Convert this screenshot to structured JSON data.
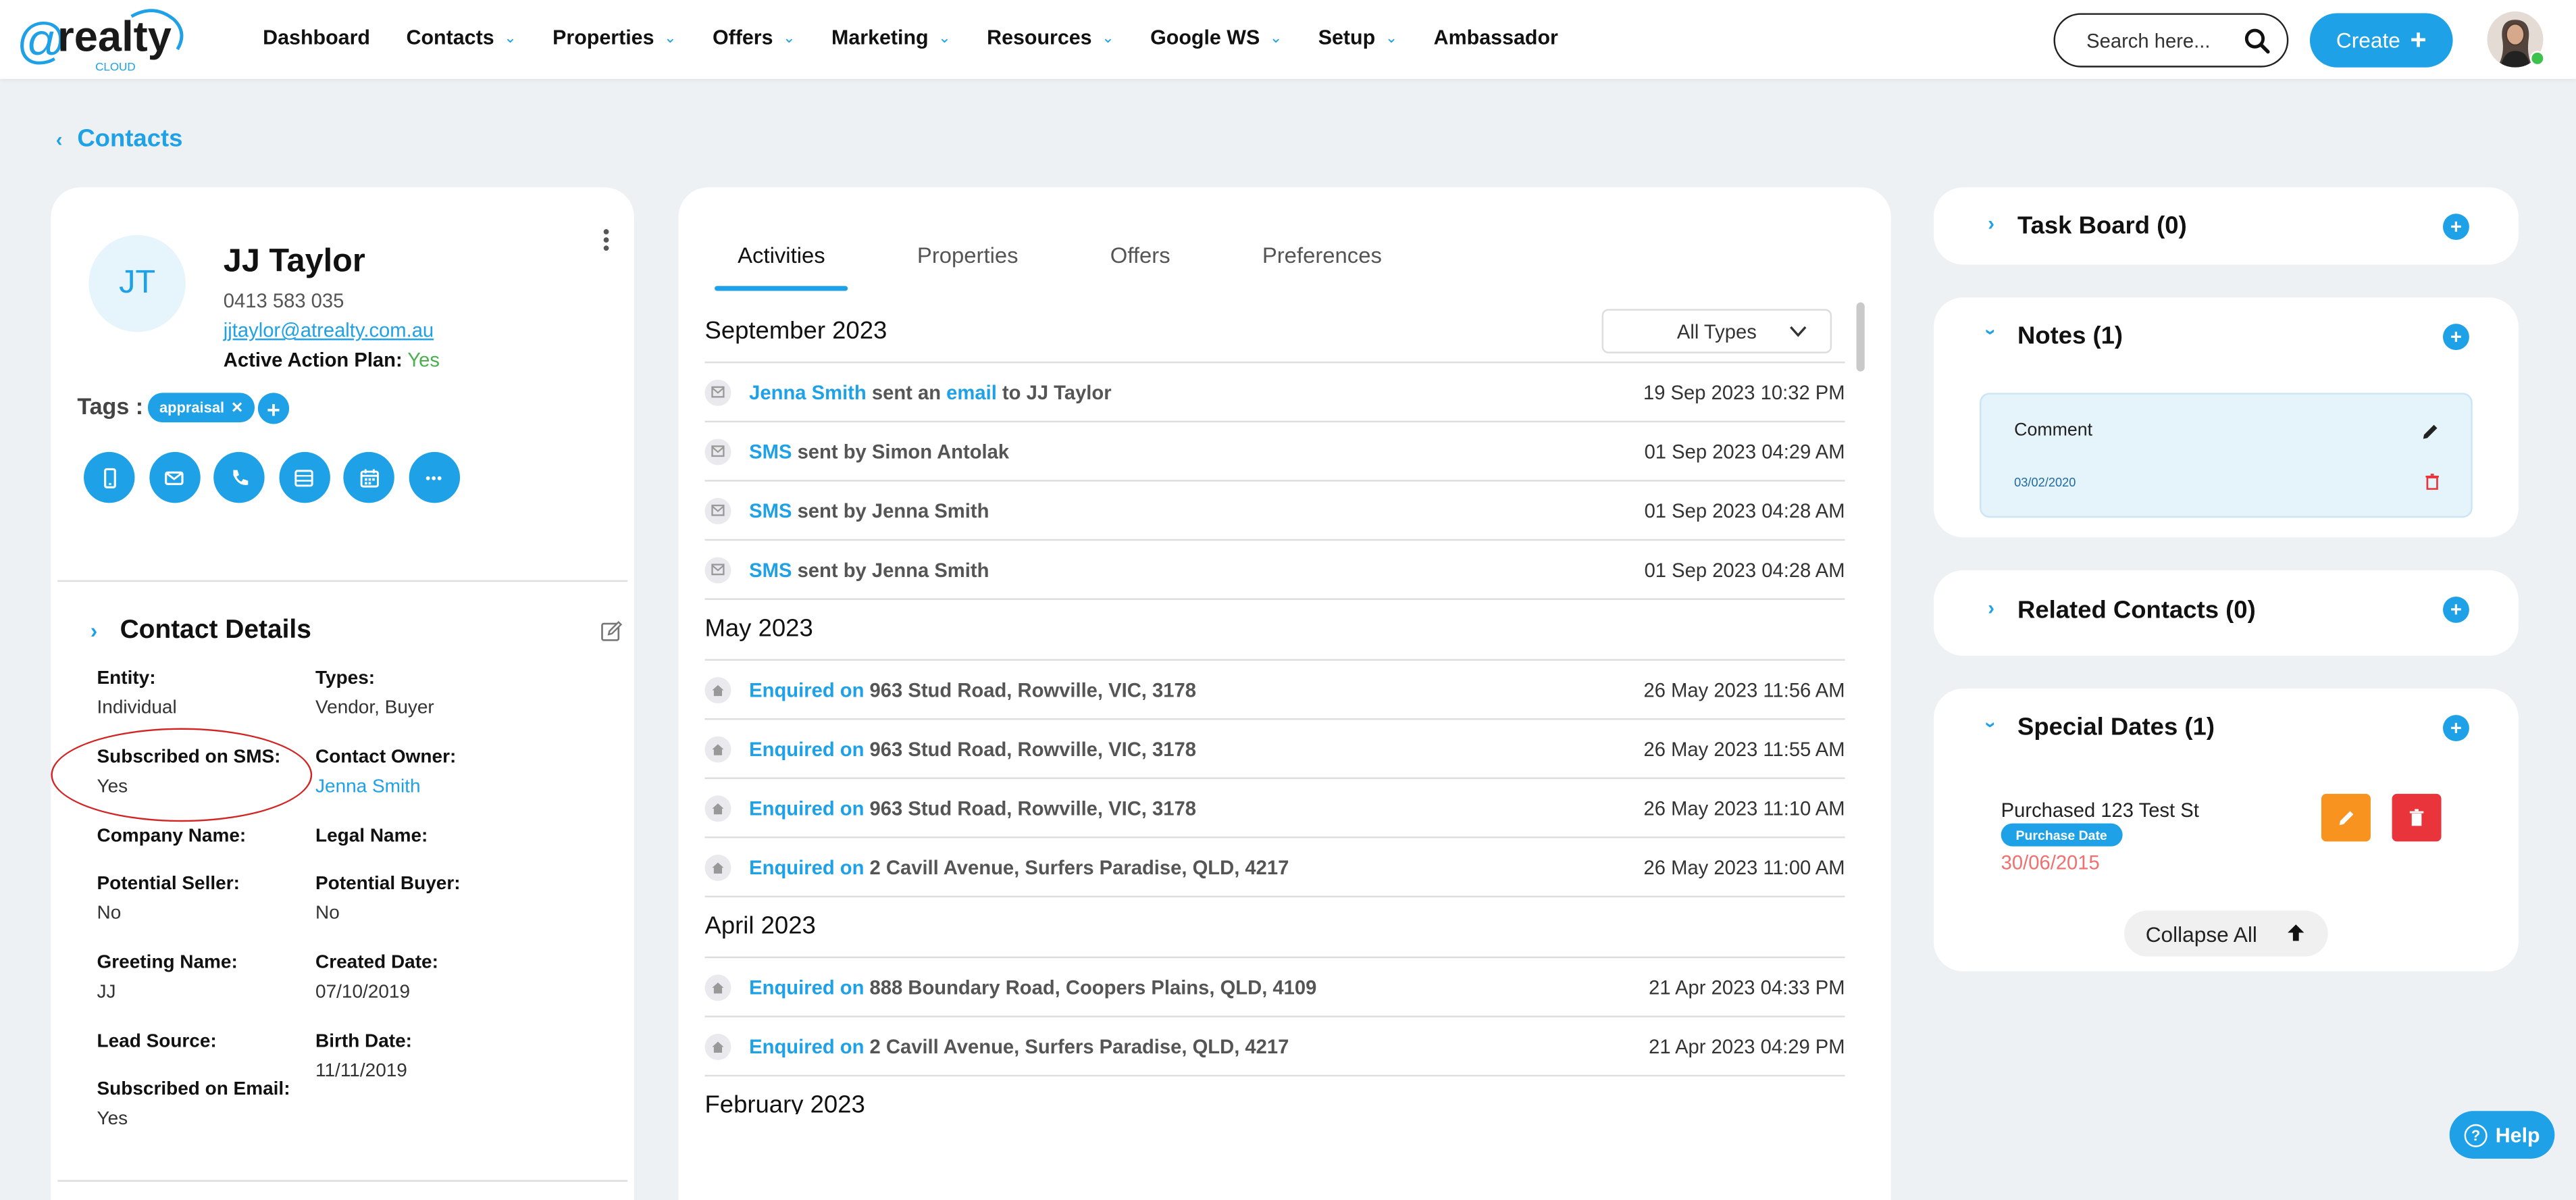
{
  "nav": {
    "logo": {
      "main": "realty",
      "sub": "CLOUD"
    },
    "items": [
      {
        "label": "Dashboard",
        "has_dropdown": false
      },
      {
        "label": "Contacts",
        "has_dropdown": true
      },
      {
        "label": "Properties",
        "has_dropdown": true
      },
      {
        "label": "Offers",
        "has_dropdown": true
      },
      {
        "label": "Marketing",
        "has_dropdown": true
      },
      {
        "label": "Resources",
        "has_dropdown": true
      },
      {
        "label": "Google WS",
        "has_dropdown": true
      },
      {
        "label": "Setup",
        "has_dropdown": true
      },
      {
        "label": "Ambassador",
        "has_dropdown": false
      }
    ],
    "search_placeholder": "Search here...",
    "create_label": "Create"
  },
  "breadcrumb": {
    "label": "Contacts"
  },
  "contact": {
    "initials": "JT",
    "name": "JJ Taylor",
    "phone": "0413 583 035",
    "email": "jjtaylor@atrealty.com.au",
    "action_plan_label": "Active Action Plan:",
    "action_plan_value": "Yes",
    "tags_label": "Tags :",
    "tags": [
      "appraisal"
    ],
    "action_icons": [
      "mobile-icon",
      "email-icon",
      "phone-icon",
      "list-icon",
      "calendar-icon",
      "more-icon"
    ]
  },
  "contact_details": {
    "title": "Contact Details",
    "fields": [
      {
        "label": "Entity:",
        "value": "Individual"
      },
      {
        "label": "Types:",
        "value": "Vendor, Buyer"
      },
      {
        "label": "Subscribed on SMS:",
        "value": "Yes"
      },
      {
        "label": "Contact Owner:",
        "value": "Jenna Smith"
      },
      {
        "label": "Company Name:",
        "value": ""
      },
      {
        "label": "Legal Name:",
        "value": ""
      },
      {
        "label": "Potential Seller:",
        "value": "No"
      },
      {
        "label": "Potential Buyer:",
        "value": "No"
      },
      {
        "label": "Greeting Name:",
        "value": "JJ"
      },
      {
        "label": "Created Date:",
        "value": "07/10/2019"
      },
      {
        "label": "Lead Source:",
        "value": ""
      },
      {
        "label": "Birth Date:",
        "value": "11/11/2019"
      },
      {
        "label": "Subscribed on Email:",
        "value": "Yes"
      }
    ]
  },
  "activity": {
    "tabs": [
      "Activities",
      "Properties",
      "Offers",
      "Preferences"
    ],
    "active_tab": "Activities",
    "filter_value": "All Types",
    "groups": [
      {
        "month": "September 2023",
        "rows": [
          {
            "icon": "email-icon",
            "p1": "Jenna Smith",
            "p2": " sent an ",
            "p3": "email",
            "p4": " to JJ Taylor",
            "date": "19 Sep 2023 10:32 PM"
          },
          {
            "icon": "email-icon",
            "p1": "SMS",
            "p2": " sent by Simon Antolak",
            "p3": "",
            "p4": "",
            "date": "01 Sep 2023 04:29 AM"
          },
          {
            "icon": "email-icon",
            "p1": "SMS",
            "p2": " sent by Jenna Smith",
            "p3": "",
            "p4": "",
            "date": "01 Sep 2023 04:28 AM"
          },
          {
            "icon": "email-icon",
            "p1": "SMS",
            "p2": " sent by Jenna Smith",
            "p3": "",
            "p4": "",
            "date": "01 Sep 2023 04:28 AM"
          }
        ]
      },
      {
        "month": "May 2023",
        "rows": [
          {
            "icon": "home-icon",
            "p1": "Enquired on",
            "p2": " 963 Stud Road, Rowville, VIC, 3178",
            "p3": "",
            "p4": "",
            "date": "26 May 2023 11:56 AM"
          },
          {
            "icon": "home-icon",
            "p1": "Enquired on",
            "p2": " 963 Stud Road, Rowville, VIC, 3178",
            "p3": "",
            "p4": "",
            "date": "26 May 2023 11:55 AM"
          },
          {
            "icon": "home-icon",
            "p1": "Enquired on",
            "p2": " 963 Stud Road, Rowville, VIC, 3178",
            "p3": "",
            "p4": "",
            "date": "26 May 2023 11:10 AM"
          },
          {
            "icon": "home-icon",
            "p1": "Enquired on",
            "p2": " 2 Cavill Avenue, Surfers Paradise, QLD, 4217",
            "p3": "",
            "p4": "",
            "date": "26 May 2023 11:00 AM"
          }
        ]
      },
      {
        "month": "April 2023",
        "rows": [
          {
            "icon": "home-icon",
            "p1": "Enquired on",
            "p2": " 888 Boundary Road, Coopers Plains, QLD, 4109",
            "p3": "",
            "p4": "",
            "date": "21 Apr 2023 04:33 PM"
          },
          {
            "icon": "home-icon",
            "p1": "Enquired on",
            "p2": " 2 Cavill Avenue, Surfers Paradise, QLD, 4217",
            "p3": "",
            "p4": "",
            "date": "21 Apr 2023 04:29 PM"
          }
        ]
      },
      {
        "month": "February 2023",
        "rows": []
      }
    ]
  },
  "right": {
    "task_board": {
      "title": "Task Board (0)"
    },
    "notes": {
      "title": "Notes (1)",
      "items": [
        {
          "title": "Comment",
          "date": "03/02/2020"
        }
      ]
    },
    "related": {
      "title": "Related Contacts (0)"
    },
    "special_dates": {
      "title": "Special Dates (1)",
      "items": [
        {
          "name": "Purchased 123 Test St",
          "badge": "Purchase Date",
          "date": "30/06/2015"
        }
      ]
    },
    "collapse_label": "Collapse All"
  },
  "help_label": "Help",
  "colors": {
    "accent": "#1ea1e6",
    "edit": "#f7931e",
    "delete": "#e8343a",
    "annotation": "#d32424",
    "yes": "#4caf50"
  }
}
